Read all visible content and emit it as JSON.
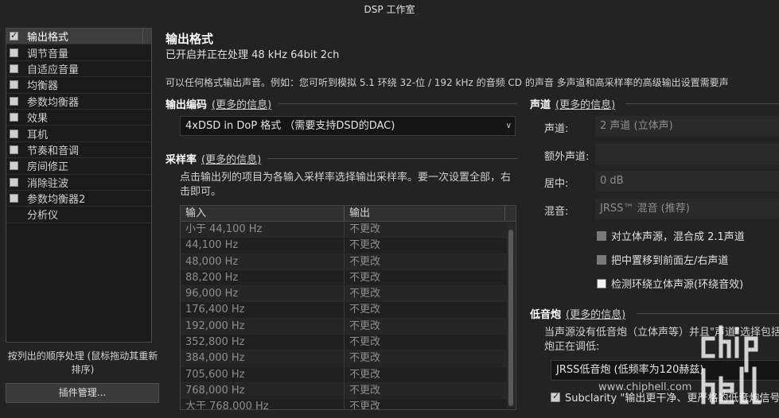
{
  "window": {
    "title": "DSP 工作室"
  },
  "sidebar": {
    "items": [
      {
        "label": "输出格式",
        "checkbox": "checked",
        "active": true
      },
      {
        "label": "调节音量",
        "checkbox": "unchecked",
        "active": false
      },
      {
        "label": "自适应音量",
        "checkbox": "unchecked",
        "active": false
      },
      {
        "label": "均衡器",
        "checkbox": "unchecked",
        "active": false
      },
      {
        "label": "参数均衡器",
        "checkbox": "unchecked",
        "active": false
      },
      {
        "label": "效果",
        "checkbox": "unchecked",
        "active": false
      },
      {
        "label": "耳机",
        "checkbox": "unchecked",
        "active": false
      },
      {
        "label": "节奏和音调",
        "checkbox": "unchecked",
        "active": false
      },
      {
        "label": "房间修正",
        "checkbox": "unchecked",
        "active": false
      },
      {
        "label": "消除驻波",
        "checkbox": "unchecked",
        "active": false
      },
      {
        "label": "参数均衡器2",
        "checkbox": "unchecked",
        "active": false
      },
      {
        "label": "分析仪",
        "checkbox": "none",
        "active": false
      }
    ],
    "order_note": "按列出的顺序处理 (鼠标拖动其重新排序)",
    "plugin_button": "插件管理..."
  },
  "main": {
    "title": "输出格式",
    "subtitle": "已开启并正在处理 48 kHz 64bit 2ch",
    "description": "可以任何格式输出声音。例如：您可听到模拟 5.1 环绕 32-位 / 192 kHz 的音频 CD 的声音  多声道和高采样率的高级输出设置需要声",
    "encoding": {
      "heading": "输出编码",
      "more": "(更多的信息)",
      "value": "4xDSD in DoP 格式 （需要支持DSD的DAC)"
    },
    "samplerate": {
      "heading": "采样率",
      "more": "(更多的信息)",
      "note": "点击输出列的项目为各输入采样率选择输出采样率。要一次设置全部，右击即可。",
      "col_input": "输入",
      "col_output": "输出",
      "rows": [
        {
          "input": "小于 44,100 Hz",
          "output": "不更改"
        },
        {
          "input": "44,100 Hz",
          "output": "不更改"
        },
        {
          "input": "48,000 Hz",
          "output": "不更改"
        },
        {
          "input": "88,200 Hz",
          "output": "不更改"
        },
        {
          "input": "96,000 Hz",
          "output": "不更改"
        },
        {
          "input": "176,400 Hz",
          "output": "不更改"
        },
        {
          "input": "192,000 Hz",
          "output": "不更改"
        },
        {
          "input": "352,800 Hz",
          "output": "不更改"
        },
        {
          "input": "384,000 Hz",
          "output": "不更改"
        },
        {
          "input": "705,600 Hz",
          "output": "不更改"
        },
        {
          "input": "768,000 Hz",
          "output": "不更改"
        },
        {
          "input": "大于 768,000 Hz",
          "output": "不更改"
        }
      ]
    },
    "channels": {
      "heading": "声道",
      "more": "(更多的信息)",
      "channel_label": "声道:",
      "channel_value": "2 声道 (立体声)",
      "extra_label": "额外声道:",
      "extra_value": "",
      "center_label": "居中:",
      "center_value": "0 dB",
      "mix_label": "混音:",
      "mix_value": "JRSS™ 混音 (推荐)",
      "opt1": "对立体声源，混合成 2.1声道",
      "opt2": "把中置移到前面左/右声道",
      "opt3": "检测环绕立体声源(环绕音效)"
    },
    "subwoofer": {
      "heading": "低音炮",
      "more": "(更多的信息)",
      "note": "当声源没有低音炮（立体声等）并且\"声道\"选择包括 炮正在调低:",
      "select_value": "JRSS低音炮 (低频率为120赫兹)",
      "subclarity_label": "Subclarity \"输出更干净、更严格的低音炮信号"
    }
  },
  "watermark": {
    "url": "www.chiphell.com"
  }
}
